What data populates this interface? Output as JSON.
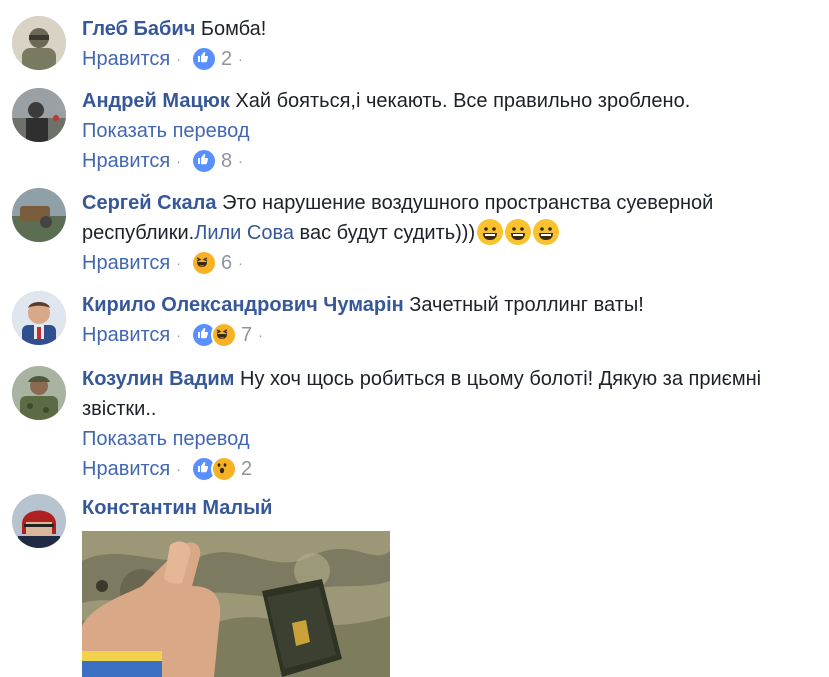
{
  "comments": [
    {
      "author": "Глеб Бабич",
      "text": "Бомба!",
      "like_label": "Нравится",
      "reaction_count": "2",
      "reactions": [
        "like"
      ]
    },
    {
      "author": "Андрей Мацюк",
      "text": "Хай бояться,і чекають. Все правильно зроблено.",
      "translate_label": "Показать перевод",
      "like_label": "Нравится",
      "reaction_count": "8",
      "reactions": [
        "like"
      ]
    },
    {
      "author": "Сергей Скала",
      "text": "Это нарушение воздушного пространства суеверной",
      "text2": "республики.",
      "mention": "Лили Сова",
      "text3": "вас будут судить)))",
      "like_label": "Нравится",
      "reaction_count": "6",
      "reactions": [
        "haha"
      ]
    },
    {
      "author": "Кирило Олександрович Чумарін",
      "text": "Зачетный троллинг ваты!",
      "like_label": "Нравится",
      "reaction_count": "7",
      "reactions": [
        "like",
        "haha"
      ]
    },
    {
      "author": "Козулин Вадим",
      "text": "Ну хоч щось робиться в цьому болоті! Дякую за приємні",
      "text2": "звістки..",
      "translate_label": "Показать перевод",
      "like_label": "Нравится",
      "reaction_count": "2",
      "reactions": [
        "like",
        "wow"
      ]
    },
    {
      "author": "Константин Малый"
    }
  ],
  "colors": {
    "author": "#365899",
    "link": "#4267b2",
    "text": "#1d2129",
    "muted": "#90949c",
    "like": "#5890ff",
    "emoji": "#f7b125"
  },
  "icons": {
    "like": "thumbs-up-icon",
    "haha": "laughing-face-icon",
    "wow": "surprised-face-icon",
    "grin": "grinning-emoji-icon"
  }
}
